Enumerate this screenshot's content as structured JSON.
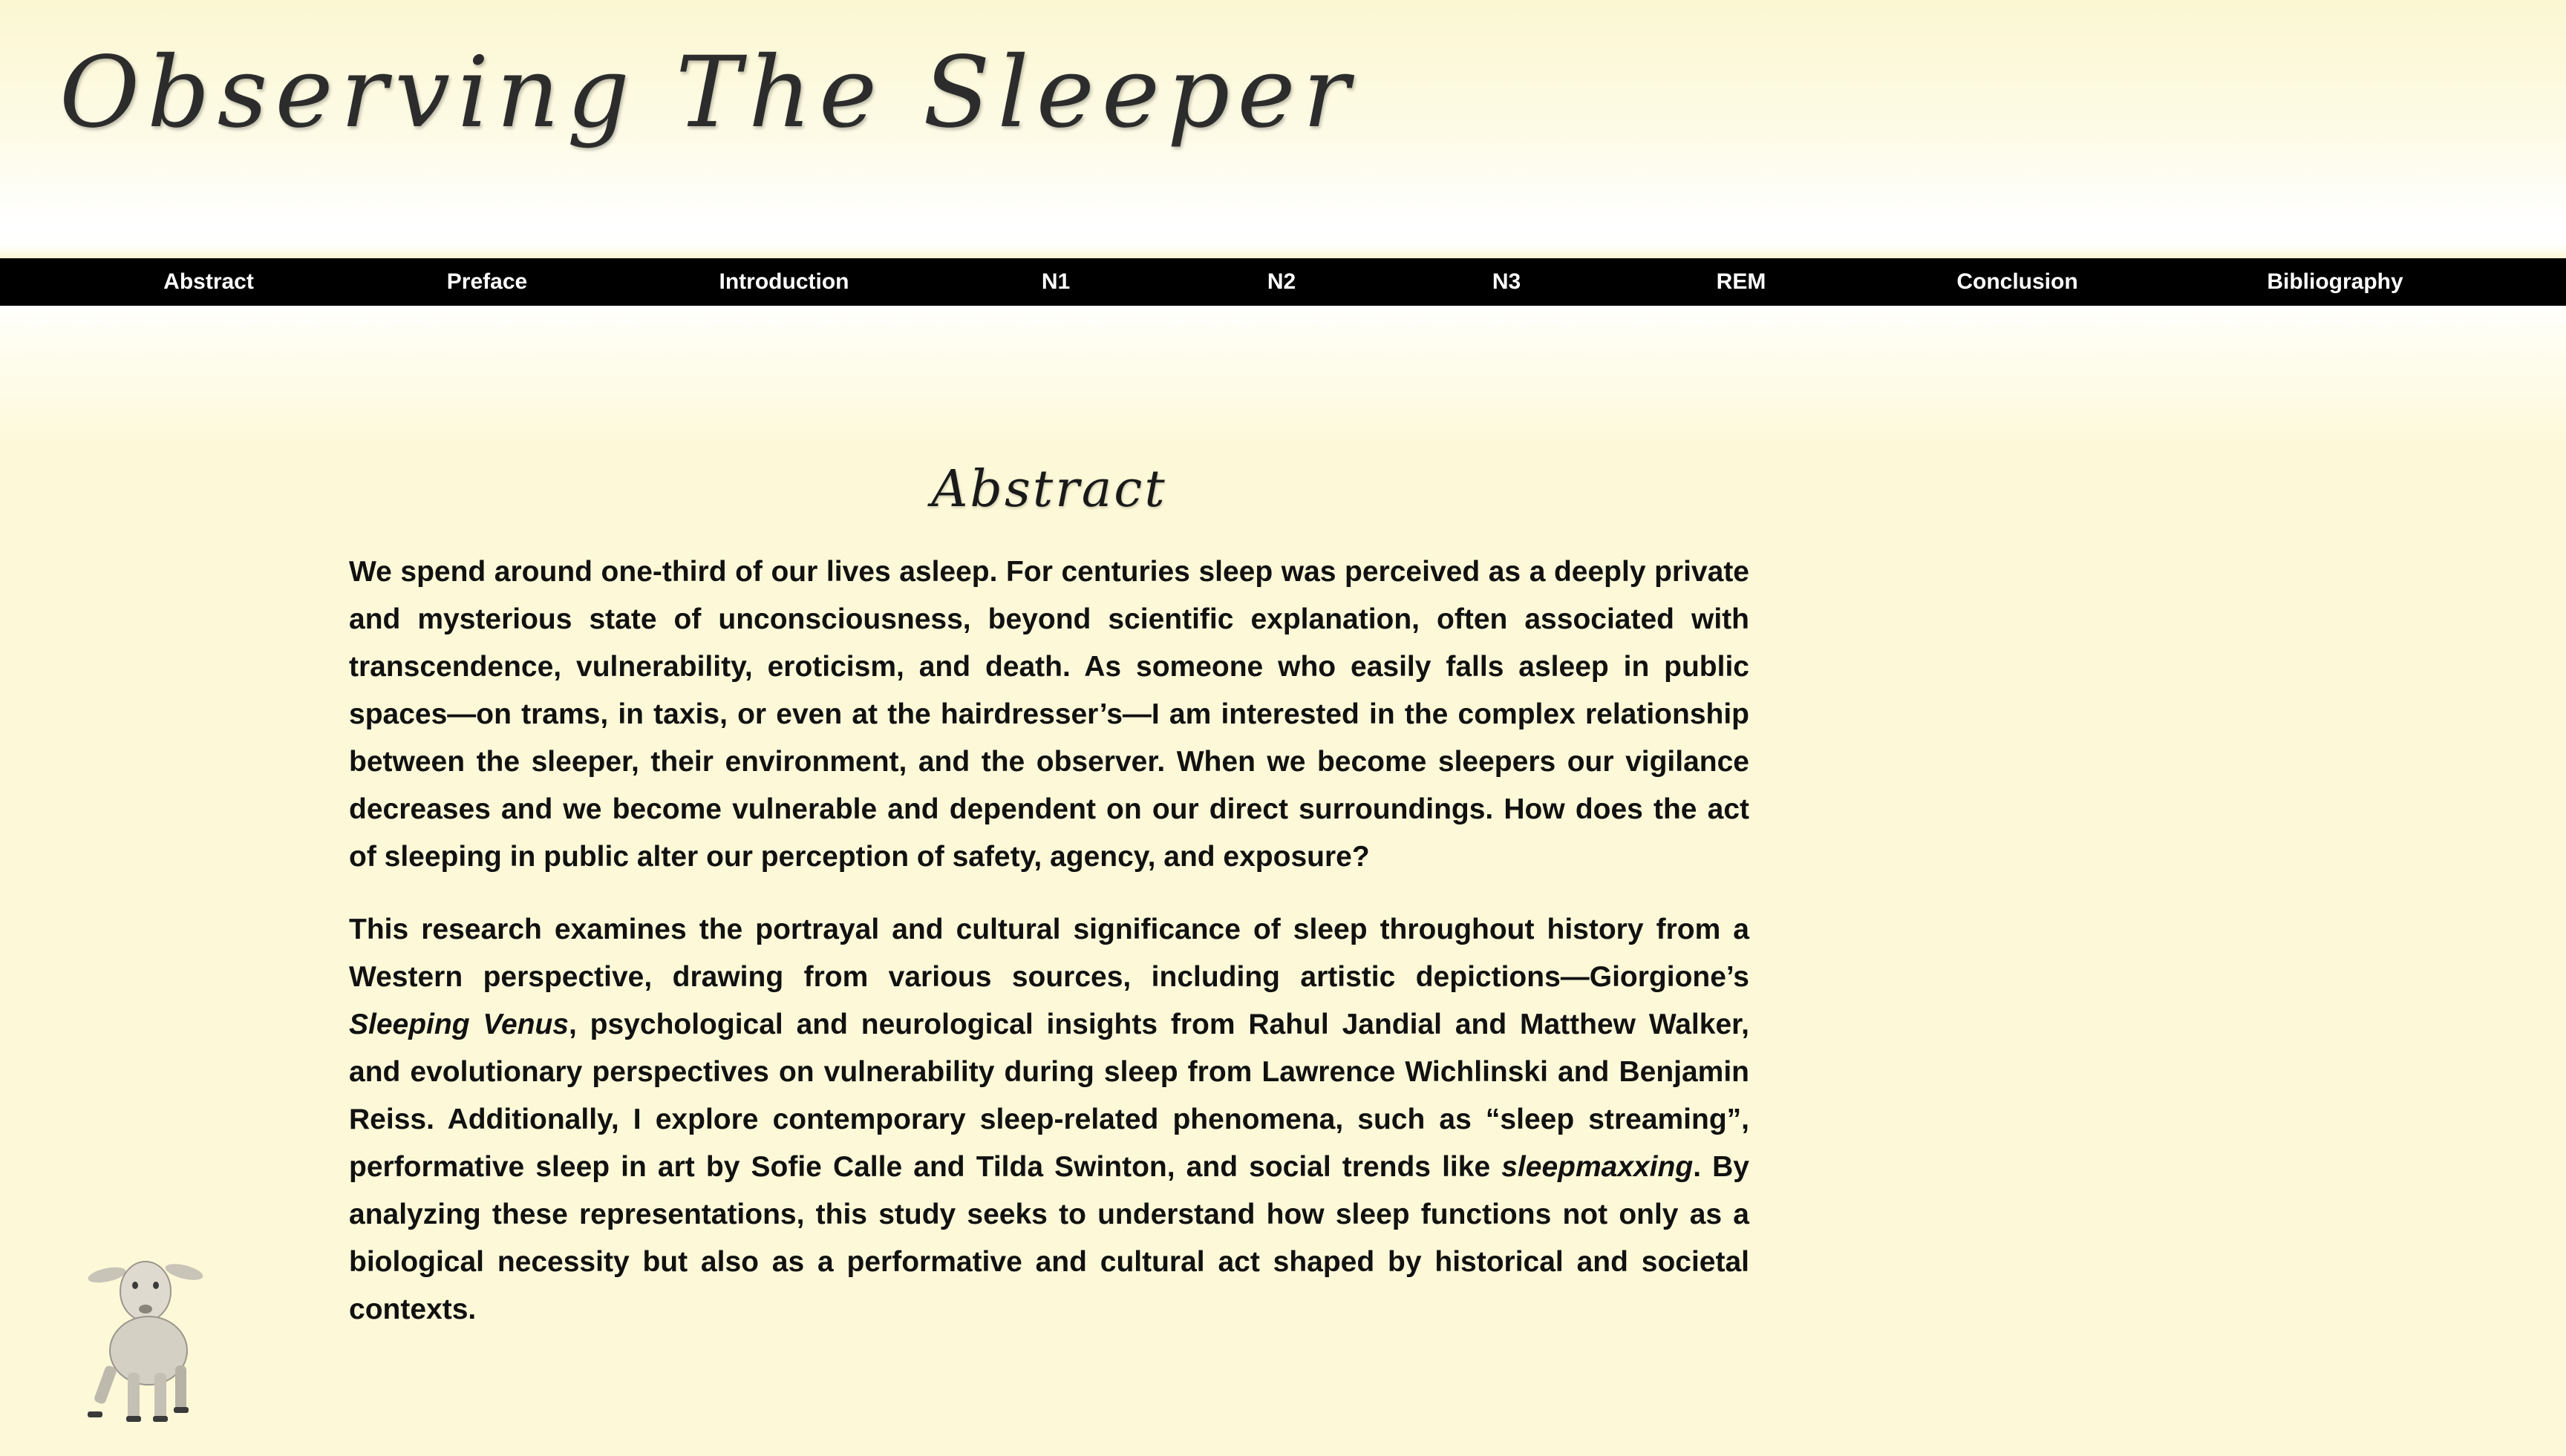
{
  "header": {
    "title": "Observing The Sleeper"
  },
  "nav": {
    "items": [
      {
        "label": "Abstract"
      },
      {
        "label": "Preface"
      },
      {
        "label": "Introduction"
      },
      {
        "label": "N1"
      },
      {
        "label": "N2"
      },
      {
        "label": "N3"
      },
      {
        "label": "REM"
      },
      {
        "label": "Conclusion"
      },
      {
        "label": "Bibliography"
      }
    ]
  },
  "main": {
    "section_title": "Abstract",
    "paragraph1": "We spend around one-third of our lives asleep. For centuries sleep was perceived as a deeply private and mysterious state of unconsciousness, beyond scientific explanation, often associated with transcendence, vulnerability, eroticism, and death. As someone who easily falls asleep in public spaces—on trams, in taxis, or even at the hairdresser’s—I am interested in the complex relationship between the sleeper, their environment, and the observer. When we become sleepers our vigilance decreases and we become vulnerable and dependent on our direct surroundings. How does the act of sleeping in public alter our perception of safety, agency, and exposure?",
    "paragraph2": {
      "part1": "This research examines the portrayal and cultural significance of sleep throughout history from a Western perspective, drawing from various sources, including artistic depictions—Giorgione’s ",
      "italic1": "Sleeping Venus",
      "part2": ", psychological and neurological insights from Rahul Jandial and Matthew Walker, and evolutionary perspectives on vulnerability during sleep from Lawrence Wichlinski and Benjamin Reiss. Additionally, I explore contemporary sleep-related phenomena, such as “sleep streaming”, performative sleep in art by Sofie Calle and Tilda Swinton, and social trends like ",
      "italic2": "sleepmaxxing",
      "part3": ". By analyzing these representations, this study seeks to understand how sleep functions not only as a biological necessity but also as a performative and cultural act shaped by historical and societal contexts."
    }
  },
  "decoration": {
    "lamb_icon": "lamb-icon"
  },
  "colors": {
    "background": "#fdf9d8",
    "nav_background": "#000000",
    "nav_text": "#ffffff",
    "title_text": "#2c2c2c"
  }
}
